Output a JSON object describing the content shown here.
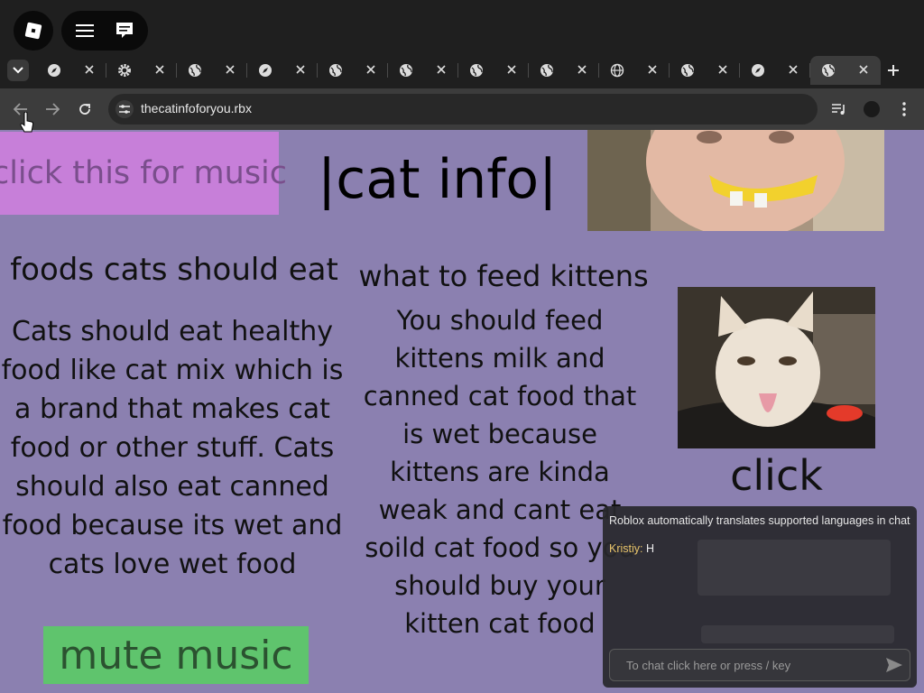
{
  "browser": {
    "url": "thecatinfoforyou.rbx",
    "tabs": [
      {
        "icon": "compass-icon",
        "active": false
      },
      {
        "icon": "gear-icon",
        "active": false
      },
      {
        "icon": "globe-icon",
        "active": false
      },
      {
        "icon": "compass-icon",
        "active": false
      },
      {
        "icon": "globe-icon",
        "active": false
      },
      {
        "icon": "globe-icon",
        "active": false
      },
      {
        "icon": "globe-icon",
        "active": false
      },
      {
        "icon": "globe-icon",
        "active": false
      },
      {
        "icon": "world-grid-icon",
        "active": false
      },
      {
        "icon": "globe-icon",
        "active": false
      },
      {
        "icon": "compass-icon",
        "active": false
      },
      {
        "icon": "globe-icon",
        "active": true
      }
    ]
  },
  "page": {
    "music_button": "click this for music",
    "title": "|cat info|",
    "left_heading": "foods cats should eat",
    "left_body": "Cats should eat healthy food like cat mix which is a brand that makes cat food or other stuff. Cats should also eat canned food because its wet and cats love wet food",
    "mid_heading": "what to feed kittens",
    "mid_body": "You should feed kittens milk and canned cat food that is wet because kittens are kinda weak and cant eat soild cat food so you should buy your kitten cat food",
    "click_label": "click",
    "mute_button": "mute music"
  },
  "chat": {
    "system_message": "Roblox automatically translates supported languages in chat",
    "messages": [
      {
        "author": "Kristiy:",
        "text": "H"
      }
    ],
    "input_placeholder": "To chat click here or press / key"
  },
  "colors": {
    "page_bg": "#8b80b0",
    "music_button_bg": "#c77fd9",
    "mute_button_bg": "#5fc46d",
    "chrome_bg": "#1f1f1f",
    "chat_author": "#e8c46a"
  }
}
